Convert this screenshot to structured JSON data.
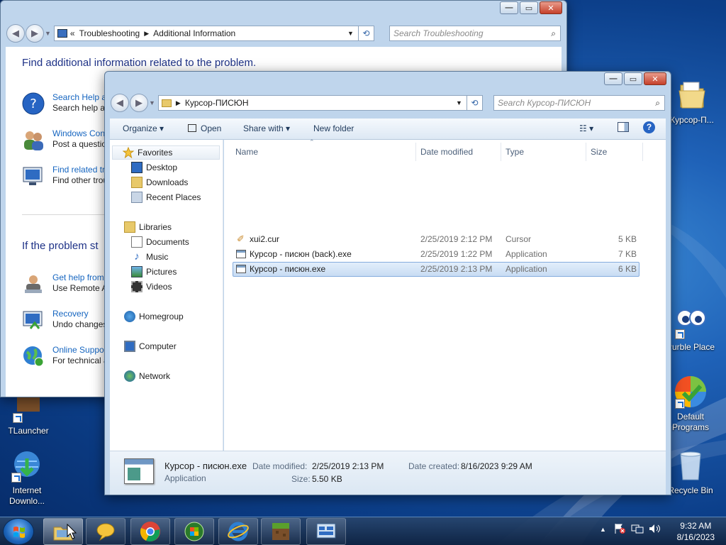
{
  "desktop": {
    "icons": [
      {
        "label": "Курсор-П..."
      },
      {
        "label": "Purble Place"
      },
      {
        "label": "Default Programs"
      },
      {
        "label": "Recycle Bin"
      },
      {
        "label": "TLauncher"
      },
      {
        "label": "Internet Downlo..."
      }
    ]
  },
  "ts_window": {
    "breadcrumb_root": "Troubleshooting",
    "breadcrumb_current": "Additional Information",
    "search_placeholder": "Search Troubleshooting",
    "heading": "Find additional information related to the problem.",
    "section2": "If the problem st",
    "items": [
      {
        "t1": "Search Help a",
        "t2": "Search help a"
      },
      {
        "t1": "Windows Con",
        "t2": "Post a questio"
      },
      {
        "t1": "Find related tr",
        "t2": "Find other trou"
      },
      {
        "t1": "Get help from",
        "t2": "Use Remote A"
      },
      {
        "t1": "Recovery",
        "t2": "Undo changes"
      },
      {
        "t1": "Online Suppor",
        "t2": "For technical a"
      }
    ]
  },
  "explorer": {
    "path": "Курсор-ПИСЮН",
    "search_placeholder": "Search Курсор-ПИСЮН",
    "toolbar": {
      "organize": "Organize",
      "open": "Open",
      "share": "Share with",
      "new_folder": "New folder"
    },
    "nav": {
      "favorites": "Favorites",
      "desktop": "Desktop",
      "downloads": "Downloads",
      "recent": "Recent Places",
      "libraries": "Libraries",
      "documents": "Documents",
      "music": "Music",
      "pictures": "Pictures",
      "videos": "Videos",
      "homegroup": "Homegroup",
      "computer": "Computer",
      "network": "Network"
    },
    "columns": {
      "name": "Name",
      "date": "Date modified",
      "type": "Type",
      "size": "Size"
    },
    "files": [
      {
        "name": "xui2.cur",
        "date": "2/25/2019 2:12 PM",
        "type": "Cursor",
        "size": "5 KB"
      },
      {
        "name": "Курсор - писюн (back).exe",
        "date": "2/25/2019 1:22 PM",
        "type": "Application",
        "size": "7 KB"
      },
      {
        "name": "Курсор - писюн.exe",
        "date": "2/25/2019 2:13 PM",
        "type": "Application",
        "size": "6 KB"
      }
    ],
    "details": {
      "name": "Курсор - писюн.exe",
      "type": "Application",
      "modified_label": "Date modified:",
      "modified": "2/25/2019 2:13 PM",
      "size_label": "Size:",
      "size": "5.50 KB",
      "created_label": "Date created:",
      "created": "8/16/2023 9:29 AM"
    }
  },
  "taskbar": {
    "time": "9:32 AM",
    "date": "8/16/2023"
  }
}
